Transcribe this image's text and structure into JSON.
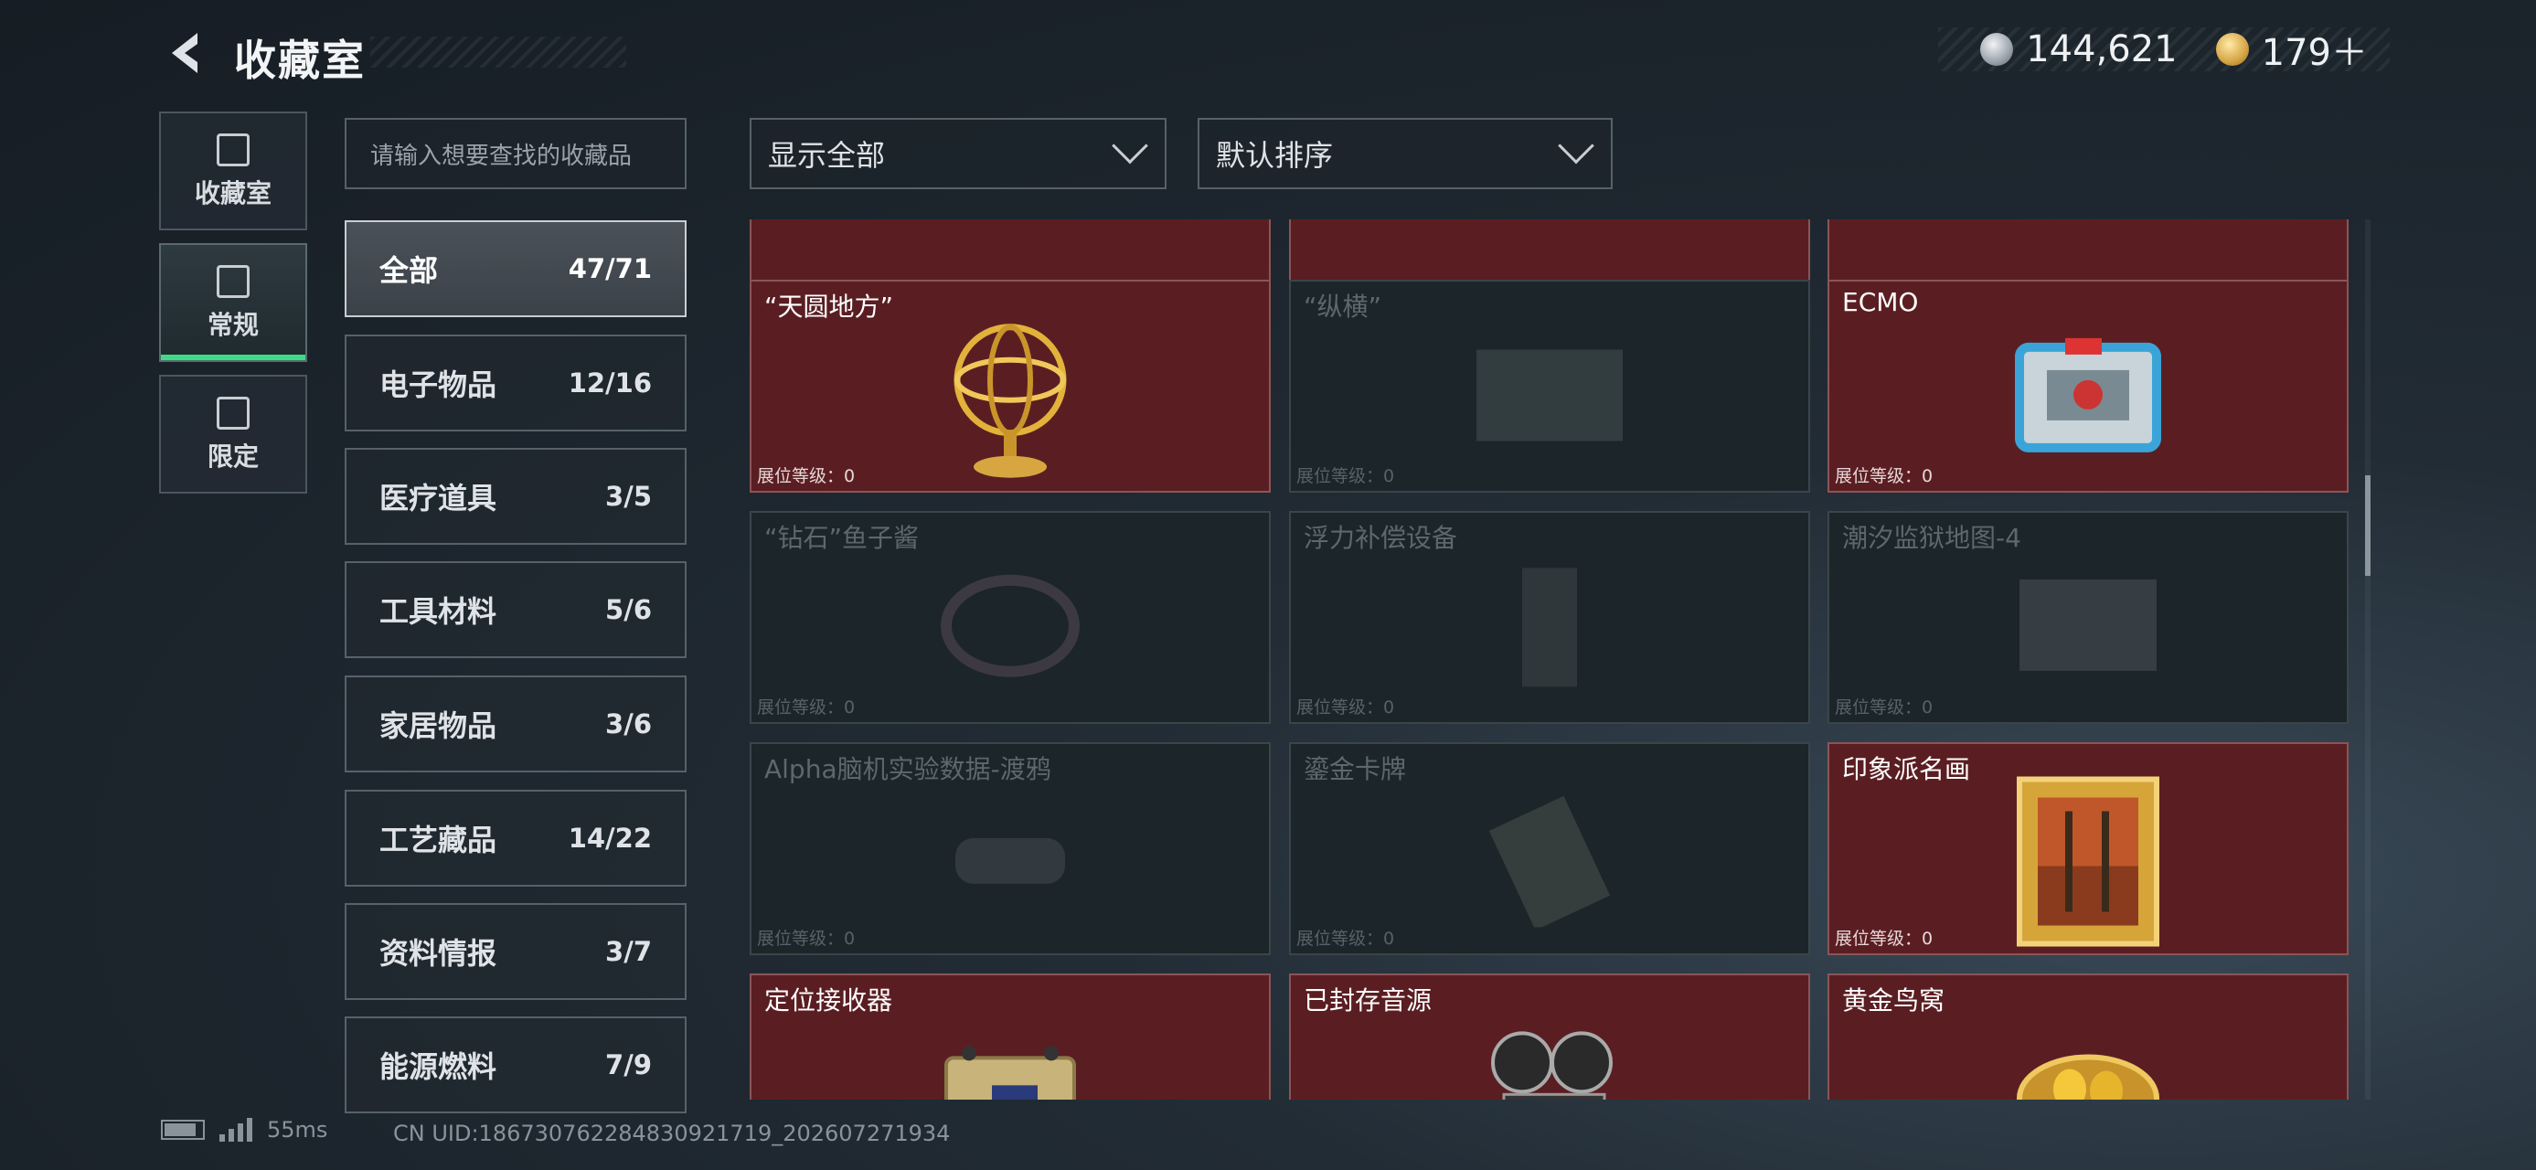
{
  "header": {
    "title": "收藏室",
    "currency": [
      {
        "icon": "silver-coin-icon",
        "value": "144,621"
      },
      {
        "icon": "gold-coin-icon",
        "value": "179＋"
      }
    ]
  },
  "left_tabs": [
    {
      "label": "收藏室",
      "icon": "collection-room-icon",
      "active": false
    },
    {
      "label": "常规",
      "icon": "regular-icon",
      "active": true
    },
    {
      "label": "限定",
      "icon": "limited-icon",
      "active": false
    }
  ],
  "search": {
    "placeholder": "请输入想要查找的收藏品"
  },
  "filters": {
    "display": "显示全部",
    "sort": "默认排序"
  },
  "categories": [
    {
      "name": "全部",
      "count": "47/71",
      "active": true
    },
    {
      "name": "电子物品",
      "count": "12/16"
    },
    {
      "name": "医疗道具",
      "count": "3/5"
    },
    {
      "name": "工具材料",
      "count": "5/6"
    },
    {
      "name": "家居物品",
      "count": "3/6"
    },
    {
      "name": "工艺藏品",
      "count": "14/22"
    },
    {
      "name": "资料情报",
      "count": "3/7"
    },
    {
      "name": "能源燃料",
      "count": "7/9"
    }
  ],
  "level_label": "展位等级：0",
  "cards": [
    {
      "name": "",
      "owned": true,
      "icon": "partial-item-icon"
    },
    {
      "name": "",
      "owned": true,
      "icon": "partial-item-icon"
    },
    {
      "name": "",
      "owned": true,
      "icon": "partial-item-icon"
    },
    {
      "name": "“天圆地方”",
      "owned": true,
      "icon": "armillary-sphere-icon"
    },
    {
      "name": "“纵横”",
      "owned": false,
      "icon": "chessboard-icon"
    },
    {
      "name": "ECMO",
      "owned": true,
      "icon": "ecmo-machine-icon"
    },
    {
      "name": "“钻石”鱼子酱",
      "owned": false,
      "icon": "caviar-tin-icon"
    },
    {
      "name": "浮力补偿设备",
      "owned": false,
      "icon": "buoyancy-device-icon"
    },
    {
      "name": "潮汐监狱地图-4",
      "owned": false,
      "icon": "map-icon"
    },
    {
      "name": "Alpha脑机实验数据-渡鸦",
      "owned": false,
      "icon": "data-drive-icon"
    },
    {
      "name": "鎏金卡牌",
      "owned": false,
      "icon": "gilded-card-icon"
    },
    {
      "name": "印象派名画",
      "owned": true,
      "icon": "framed-painting-icon"
    },
    {
      "name": "定位接收器",
      "owned": true,
      "icon": "locator-receiver-icon"
    },
    {
      "name": "已封存音源",
      "owned": true,
      "icon": "film-projector-icon"
    },
    {
      "name": "黄金鸟窝",
      "owned": true,
      "icon": "golden-nest-icon"
    }
  ],
  "footer": {
    "battery_level": 0.85,
    "ping": "55ms",
    "uid": "CN UID:18673076228483092171​9_202607271934"
  }
}
